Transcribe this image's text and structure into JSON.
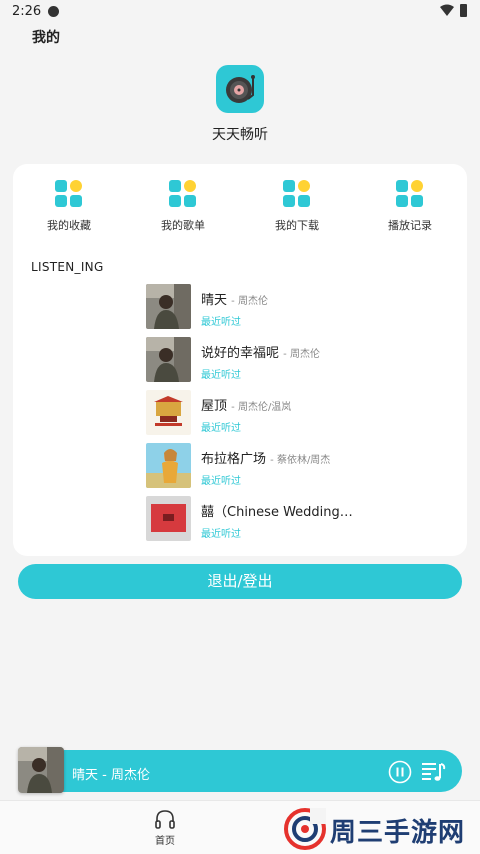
{
  "status": {
    "time": "2:26"
  },
  "page": {
    "title": "我的"
  },
  "profile": {
    "name": "天天畅听"
  },
  "quick_actions": [
    {
      "label": "我的收藏",
      "icon": "grid-icon"
    },
    {
      "label": "我的歌单",
      "icon": "grid-icon"
    },
    {
      "label": "我的下载",
      "icon": "grid-icon"
    },
    {
      "label": "播放记录",
      "icon": "grid-icon"
    }
  ],
  "recent": {
    "section_title": "LISTEN_ING",
    "songs": [
      {
        "title": "晴天",
        "artist": "- 周杰伦",
        "hint": "最近听过"
      },
      {
        "title": "说好的幸福呢",
        "artist": "- 周杰伦",
        "hint": "最近听过"
      },
      {
        "title": "屋顶",
        "artist": "- 周杰伦/温岚",
        "hint": "最近听过"
      },
      {
        "title": "布拉格广场",
        "artist": "- 蔡依林/周杰",
        "hint": "最近听过"
      },
      {
        "title": "囍（Chinese Wedding…",
        "artist": "",
        "hint": "最近听过"
      }
    ]
  },
  "logout": {
    "label": "退出/登出"
  },
  "player": {
    "now_playing": "晴天 - 周杰伦"
  },
  "nav": {
    "home_label": "首页"
  },
  "watermark": {
    "text": "周三手游网"
  },
  "colors": {
    "accent": "#2ec8d5",
    "yellow": "#ffd233",
    "watermark": "#1f3e73",
    "watermark_red": "#e5322d"
  }
}
